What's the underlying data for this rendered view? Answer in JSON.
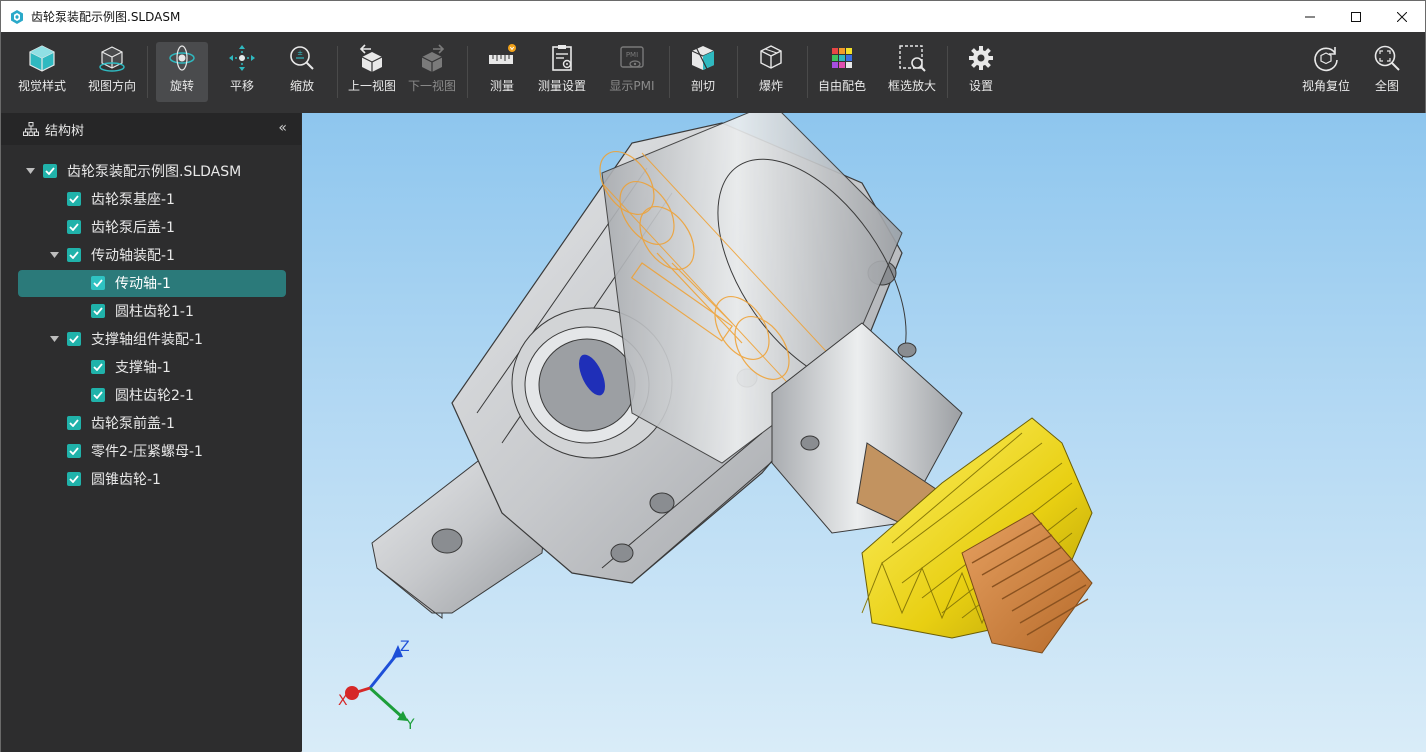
{
  "window": {
    "title": "齿轮泵装配示例图.SLDASM",
    "controls": [
      "minimize",
      "maximize",
      "close"
    ]
  },
  "toolbar": {
    "items": [
      {
        "label": "视觉样式",
        "icon": "cube-style-icon",
        "state": "normal"
      },
      {
        "label": "视图方向",
        "icon": "view-direction-icon",
        "state": "normal"
      },
      {
        "label": "旋转",
        "icon": "rotate-icon",
        "state": "active"
      },
      {
        "label": "平移",
        "icon": "pan-icon",
        "state": "normal"
      },
      {
        "label": "缩放",
        "icon": "zoom-icon",
        "state": "normal"
      },
      {
        "label": "上一视图",
        "icon": "previous-view-icon",
        "state": "normal"
      },
      {
        "label": "下一视图",
        "icon": "next-view-icon",
        "state": "disabled"
      },
      {
        "label": "测量",
        "icon": "measure-icon",
        "state": "normal"
      },
      {
        "label": "测量设置",
        "icon": "measure-settings-icon",
        "state": "normal"
      },
      {
        "label": "显示PMI",
        "icon": "pmi-icon",
        "state": "disabled"
      },
      {
        "label": "剖切",
        "icon": "section-icon",
        "state": "normal"
      },
      {
        "label": "爆炸",
        "icon": "explode-icon",
        "state": "normal"
      },
      {
        "label": "自由配色",
        "icon": "color-palette-icon",
        "state": "normal"
      },
      {
        "label": "框选放大",
        "icon": "box-zoom-icon",
        "state": "normal"
      },
      {
        "label": "设置",
        "icon": "gear-icon",
        "state": "normal"
      }
    ],
    "right_items": [
      {
        "label": "视角复位",
        "icon": "reset-view-icon"
      },
      {
        "label": "全图",
        "icon": "zoom-fit-icon"
      }
    ],
    "pmi_badge": "PMI"
  },
  "sidebar": {
    "title": "结构树",
    "collapse_glyph": "«",
    "tree": [
      {
        "label": "齿轮泵装配示例图.SLDASM",
        "level": 0,
        "expanded": true,
        "checked": true
      },
      {
        "label": "齿轮泵基座-1",
        "level": 1,
        "checked": true
      },
      {
        "label": "齿轮泵后盖-1",
        "level": 1,
        "checked": true
      },
      {
        "label": "传动轴装配-1",
        "level": 1,
        "expanded": true,
        "checked": true
      },
      {
        "label": "传动轴-1",
        "level": 2,
        "checked": true,
        "selected": true
      },
      {
        "label": "圆柱齿轮1-1",
        "level": 2,
        "checked": true
      },
      {
        "label": "支撑轴组件装配-1",
        "level": 1,
        "expanded": true,
        "checked": true
      },
      {
        "label": "支撑轴-1",
        "level": 2,
        "checked": true
      },
      {
        "label": "圆柱齿轮2-1",
        "level": 2,
        "checked": true
      },
      {
        "label": "齿轮泵前盖-1",
        "level": 1,
        "checked": true
      },
      {
        "label": "零件2-压紧螺母-1",
        "level": 1,
        "checked": true
      },
      {
        "label": "圆锥齿轮-1",
        "level": 1,
        "checked": true
      }
    ]
  },
  "viewport": {
    "axes": {
      "x": "X",
      "y": "Y",
      "z": "Z"
    },
    "colors": {
      "x_axis": "#d62828",
      "y_axis": "#1c9e3a",
      "z_axis": "#1d4fd8",
      "bevel_gear": "#f2dc1a",
      "shaft": "#d98a3a",
      "housing": "#c8cacc"
    }
  },
  "theme": {
    "accent": "#20b2aa",
    "selected_row": "#2b7a7a",
    "toolbar_bg": "#333334"
  }
}
